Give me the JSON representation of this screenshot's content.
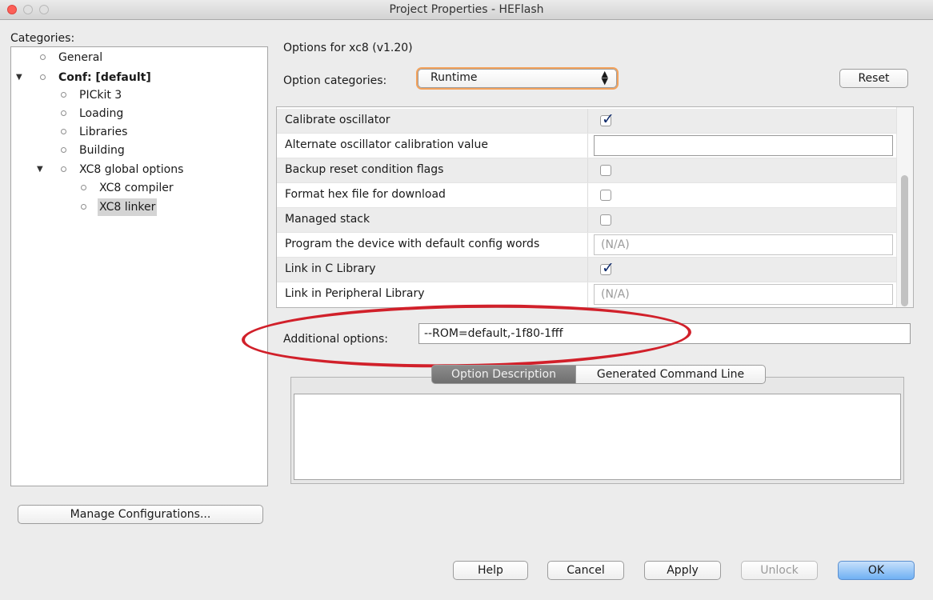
{
  "window": {
    "title": "Project Properties - HEFlash"
  },
  "sidebar": {
    "header": "Categories:",
    "tree": [
      {
        "label": "General",
        "level": 1,
        "expandable": false,
        "bold": false,
        "selected": false
      },
      {
        "label": "Conf: [default]",
        "level": 1,
        "expandable": true,
        "bold": true,
        "selected": false
      },
      {
        "label": "PICkit 3",
        "level": 2,
        "expandable": false,
        "bold": false,
        "selected": false
      },
      {
        "label": "Loading",
        "level": 2,
        "expandable": false,
        "bold": false,
        "selected": false
      },
      {
        "label": "Libraries",
        "level": 2,
        "expandable": false,
        "bold": false,
        "selected": false
      },
      {
        "label": "Building",
        "level": 2,
        "expandable": false,
        "bold": false,
        "selected": false
      },
      {
        "label": "XC8 global options",
        "level": 2,
        "expandable": true,
        "bold": false,
        "selected": false
      },
      {
        "label": "XC8 compiler",
        "level": 3,
        "expandable": false,
        "bold": false,
        "selected": false
      },
      {
        "label": "XC8 linker",
        "level": 3,
        "expandable": false,
        "bold": false,
        "selected": true
      }
    ],
    "manage_button": "Manage Configurations..."
  },
  "options": {
    "title": "Options for xc8 (v1.20)",
    "category_label": "Option categories:",
    "category_value": "Runtime",
    "reset_button": "Reset",
    "rows": [
      {
        "label": "Calibrate oscillator",
        "type": "checkbox",
        "checked": true
      },
      {
        "label": "Alternate oscillator calibration value",
        "type": "text",
        "value": ""
      },
      {
        "label": "Backup reset condition flags",
        "type": "checkbox",
        "checked": false
      },
      {
        "label": "Format hex file for download",
        "type": "checkbox",
        "checked": false
      },
      {
        "label": "Managed stack",
        "type": "checkbox",
        "checked": false
      },
      {
        "label": "Program the device with default config words",
        "type": "text",
        "value": "(N/A)"
      },
      {
        "label": "Link in C Library",
        "type": "checkbox",
        "checked": true
      },
      {
        "label": "Link in Peripheral Library",
        "type": "text",
        "value": "(N/A)"
      }
    ],
    "additional_label": "Additional options:",
    "additional_value": "--ROM=default,-1f80-1fff",
    "tabs": [
      "Option Description",
      "Generated Command Line"
    ]
  },
  "footer": {
    "help": "Help",
    "cancel": "Cancel",
    "apply": "Apply",
    "unlock": "Unlock",
    "ok": "OK"
  },
  "colors": {
    "highlight_ellipse": "#d1202a",
    "close_button": "#fc5f57",
    "ok_button": "#6fb0f3",
    "combo_focus": "#f3a25c"
  }
}
